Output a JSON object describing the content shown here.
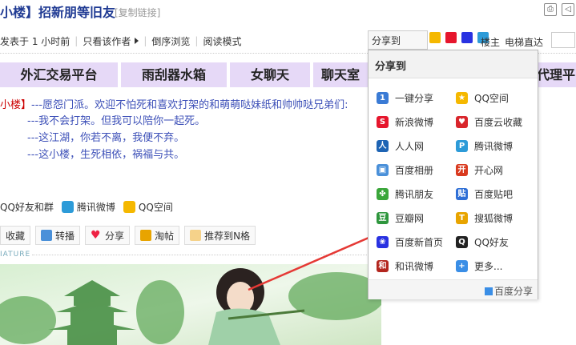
{
  "header": {
    "title": "小楼】招新朋等旧友",
    "copy_link": "[复制链接]"
  },
  "meta": {
    "posted": "发表于 1 小时前",
    "only_author": "只看该作者",
    "reverse": "倒序浏览",
    "read_mode": "阅读模式",
    "share_to": "分享到",
    "louzhu": "楼主",
    "elevator": "电梯直达"
  },
  "ads": [
    "外汇交易平台",
    "雨刮器水箱",
    "女聊天",
    "聊天室",
    "代理平"
  ],
  "post": {
    "floor_tag": "小楼】",
    "lines": [
      "---愿怨门派。欢迎不怕死和喜欢打架的和萌萌哒妹纸和帅帅哒兄弟们:",
      "---我不会打架。但我可以陪你一起死。",
      "---这江湖，你若不离，我便不弃。",
      "---这小楼，生死相依，祸福与共。"
    ]
  },
  "share_row": {
    "qq_friends": "QQ好友和群",
    "tencent_weibo": "腾讯微博",
    "qzone": "QQ空间"
  },
  "actions": [
    "收藏",
    "转播",
    "分享",
    "淘帖",
    "推荐到N格"
  ],
  "signature_label": "IATURE",
  "popup": {
    "title": "分享到",
    "items": [
      {
        "label": "一键分享",
        "icon": "one-click-share-icon",
        "color": "#3a7bd5",
        "glyph": "1"
      },
      {
        "label": "QQ空间",
        "icon": "qzone-icon",
        "color": "#f5b800",
        "glyph": "★"
      },
      {
        "label": "新浪微博",
        "icon": "sina-weibo-icon",
        "color": "#e6162d",
        "glyph": "S"
      },
      {
        "label": "百度云收藏",
        "icon": "baidu-cloud-favorite-icon",
        "color": "#d9262c",
        "glyph": "♥"
      },
      {
        "label": "人人网",
        "icon": "renren-icon",
        "color": "#1e64b4",
        "glyph": "人"
      },
      {
        "label": "腾讯微博",
        "icon": "tencent-weibo-icon",
        "color": "#2d9bd8",
        "glyph": "P"
      },
      {
        "label": "百度相册",
        "icon": "baidu-album-icon",
        "color": "#4a90d9",
        "glyph": "▣"
      },
      {
        "label": "开心网",
        "icon": "kaixin-icon",
        "color": "#d93a1f",
        "glyph": "开"
      },
      {
        "label": "腾讯朋友",
        "icon": "tencent-pengyou-icon",
        "color": "#3aa63a",
        "glyph": "✤"
      },
      {
        "label": "百度贴吧",
        "icon": "baidu-tieba-icon",
        "color": "#2f6fd6",
        "glyph": "贴"
      },
      {
        "label": "豆瓣网",
        "icon": "douban-icon",
        "color": "#2e963d",
        "glyph": "豆"
      },
      {
        "label": "搜狐微博",
        "icon": "sohu-weibo-icon",
        "color": "#e8a400",
        "glyph": "T"
      },
      {
        "label": "百度新首页",
        "icon": "baidu-home-icon",
        "color": "#2932e1",
        "glyph": "❀"
      },
      {
        "label": "QQ好友",
        "icon": "qq-friend-icon",
        "color": "#222222",
        "glyph": "Q"
      },
      {
        "label": "和讯微博",
        "icon": "hexun-weibo-icon",
        "color": "#b3261e",
        "glyph": "和"
      },
      {
        "label": "更多...",
        "icon": "more-icon",
        "color": "#3a8ee6",
        "glyph": "+"
      }
    ],
    "footer": "百度分享"
  }
}
